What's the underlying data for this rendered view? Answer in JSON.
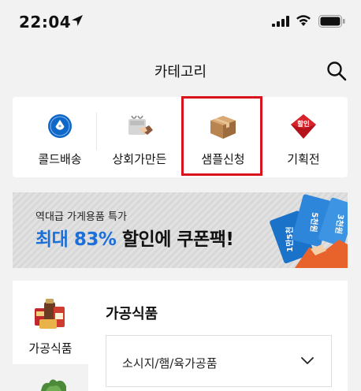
{
  "status_bar": {
    "time": "22:04"
  },
  "header": {
    "title": "카테고리"
  },
  "categories": [
    {
      "label": "콜드배송",
      "icon": "snowflake-badge-icon"
    },
    {
      "label": "상회가만든",
      "icon": "bag-hand-icon"
    },
    {
      "label": "샘플신청",
      "icon": "box-icon"
    },
    {
      "label": "기획전",
      "icon": "sale-tag-icon",
      "badge": "할인"
    }
  ],
  "banner": {
    "subtitle": "역대급 가게용품 특가",
    "headline_prefix": "최대 83%",
    "headline_suffix": " 할인에 쿠폰팩!",
    "ticket_texts": [
      "1만5천",
      "5천원",
      "3천원"
    ]
  },
  "side_nav": {
    "items": [
      {
        "label": "가공식품"
      }
    ]
  },
  "section": {
    "title": "가공식품",
    "subcategories": [
      {
        "label": "소시지/햄/육가공품"
      }
    ]
  },
  "colors": {
    "accent": "#1a6fd8",
    "highlight": "#d9121b",
    "background": "#f2f2f2"
  }
}
